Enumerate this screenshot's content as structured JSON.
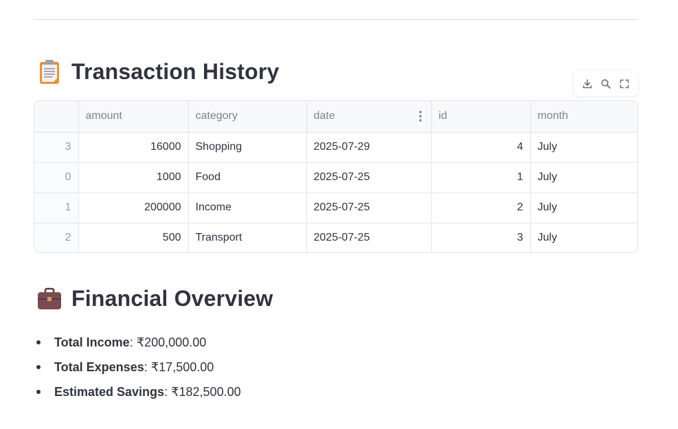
{
  "transaction_history": {
    "title": "Transaction History",
    "icon": "clipboard-icon",
    "toolbar": {
      "icons": [
        "download-icon",
        "search-icon",
        "fullscreen-icon"
      ]
    },
    "table": {
      "columns": [
        "",
        "amount",
        "category",
        "date",
        "id",
        "month"
      ],
      "rows": [
        {
          "index": "3",
          "amount": "16000",
          "category": "Shopping",
          "date": "2025-07-29",
          "id": "4",
          "month": "July"
        },
        {
          "index": "0",
          "amount": "1000",
          "category": "Food",
          "date": "2025-07-25",
          "id": "1",
          "month": "July"
        },
        {
          "index": "1",
          "amount": "200000",
          "category": "Income",
          "date": "2025-07-25",
          "id": "2",
          "month": "July"
        },
        {
          "index": "2",
          "amount": "500",
          "category": "Transport",
          "date": "2025-07-25",
          "id": "3",
          "month": "July"
        }
      ]
    }
  },
  "financial_overview": {
    "title": "Financial Overview",
    "icon": "briefcase-icon",
    "items": [
      {
        "label": "Total Income",
        "value": ": ₹200,000.00"
      },
      {
        "label": "Total Expenses",
        "value": ": ₹17,500.00"
      },
      {
        "label": "Estimated Savings",
        "value": ": ₹182,500.00"
      }
    ]
  },
  "colors": {
    "text": "#31333f",
    "muted": "#7e818c",
    "border": "#e3e4e8"
  }
}
